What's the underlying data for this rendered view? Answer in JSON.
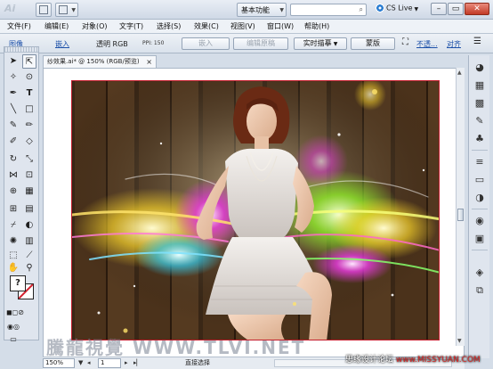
{
  "app": {
    "logo": "Ai",
    "workspace": "基本功能",
    "cs_live": "CS Live"
  },
  "menu": [
    "文件(F)",
    "编辑(E)",
    "对象(O)",
    "文字(T)",
    "选择(S)",
    "效果(C)",
    "视图(V)",
    "窗口(W)",
    "帮助(H)"
  ],
  "controlbar": {
    "link_label": "图像",
    "embed_link": "嵌入",
    "transparency": "透明 RGB",
    "ppi": "PPI: 150",
    "embed_button": "嵌入",
    "edit_original_button": "编辑原稿",
    "live_trace_button": "实时描摹",
    "mask_button": "蒙版",
    "opacity_link": "不透...",
    "align_link": "对齐"
  },
  "document": {
    "tab_title": "纱效果.ai* @ 150% (RGB/预览)",
    "close": "×"
  },
  "status": {
    "zoom": "150%",
    "page": "1",
    "tool": "直接选择"
  },
  "watermark": "騰龍視覺 WWW.TLVI.NET",
  "site_tag": {
    "prefix": "思缘设计论坛 ",
    "url": "www.MISSYUAN.COM"
  },
  "colors": {
    "accent_link": "#1b4fa8",
    "artboard_border": "#c41e2e",
    "close_button": "#c23a26"
  },
  "icons": {
    "toolbox": [
      "selection-tool",
      "direct-selection-tool",
      "magic-wand-tool",
      "lasso-tool",
      "pen-tool",
      "type-tool",
      "line-tool",
      "rectangle-tool",
      "paintbrush-tool",
      "pencil-tool",
      "blob-brush-tool",
      "eraser-tool",
      "rotate-tool",
      "scale-tool",
      "width-tool",
      "free-transform-tool",
      "shape-builder-tool",
      "perspective-tool",
      "mesh-tool",
      "gradient-tool",
      "eyedropper-tool",
      "blend-tool",
      "symbol-sprayer-tool",
      "column-graph-tool",
      "artboard-tool",
      "slice-tool",
      "hand-tool",
      "zoom-tool"
    ],
    "dock": [
      "color-panel",
      "color-guide-panel",
      "swatches-panel",
      "brushes-panel",
      "symbols-panel",
      "stroke-panel",
      "gradient-panel",
      "transparency-panel",
      "appearance-panel",
      "graphic-styles-panel",
      "layers-panel",
      "artboards-panel"
    ]
  }
}
